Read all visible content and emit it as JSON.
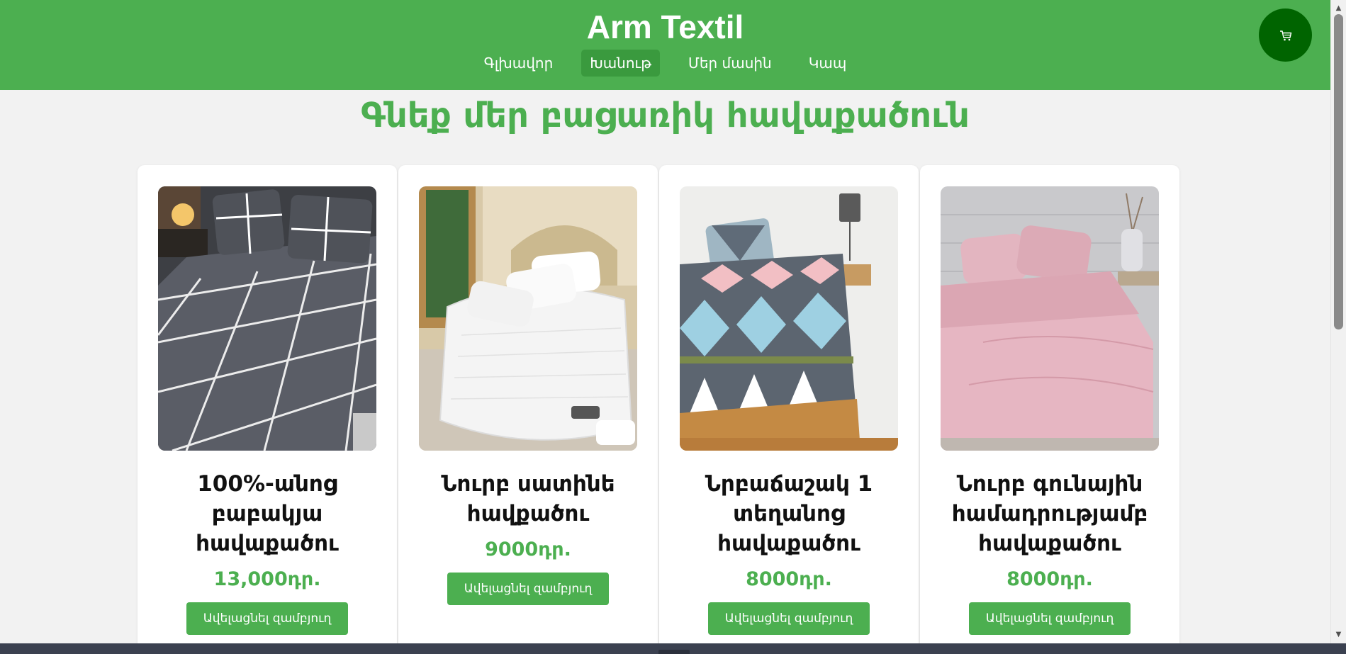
{
  "header": {
    "site_title": "Arm Textil",
    "nav": [
      {
        "label": "Գլխավոր",
        "active": false
      },
      {
        "label": "Խանութ",
        "active": true
      },
      {
        "label": "Մեր մասին",
        "active": false
      },
      {
        "label": "Կապ",
        "active": false
      }
    ],
    "cart_icon": "cart-icon",
    "brand_color": "#4caf50",
    "cart_color": "#006400"
  },
  "main": {
    "heading": "Գնեք մեր բացառիկ հավաքածուն",
    "products": [
      {
        "title": "100%-անոց բաբակյա հավաքածու",
        "price": "13,000դր.",
        "button_label": "Ավելացնել զամբյուղ",
        "image": "gray-checked-bedding-image"
      },
      {
        "title": "Նուրբ սատինե հավքածու",
        "price": "9000դր.",
        "button_label": "Ավելացնել զամբյուղ",
        "image": "white-satin-bedding-image"
      },
      {
        "title": "Նրբաճաշակ 1 տեղանոց հավաքածու",
        "price": "8000դր.",
        "button_label": "Ավելացնել զամբյուղ",
        "image": "diamond-pattern-bedding-image"
      },
      {
        "title": "Նուրբ գունային համադրությամբ հավաքածու",
        "price": "8000դր.",
        "button_label": "Ավելացնել զամբյուղ",
        "image": "pink-bedding-image"
      }
    ]
  }
}
